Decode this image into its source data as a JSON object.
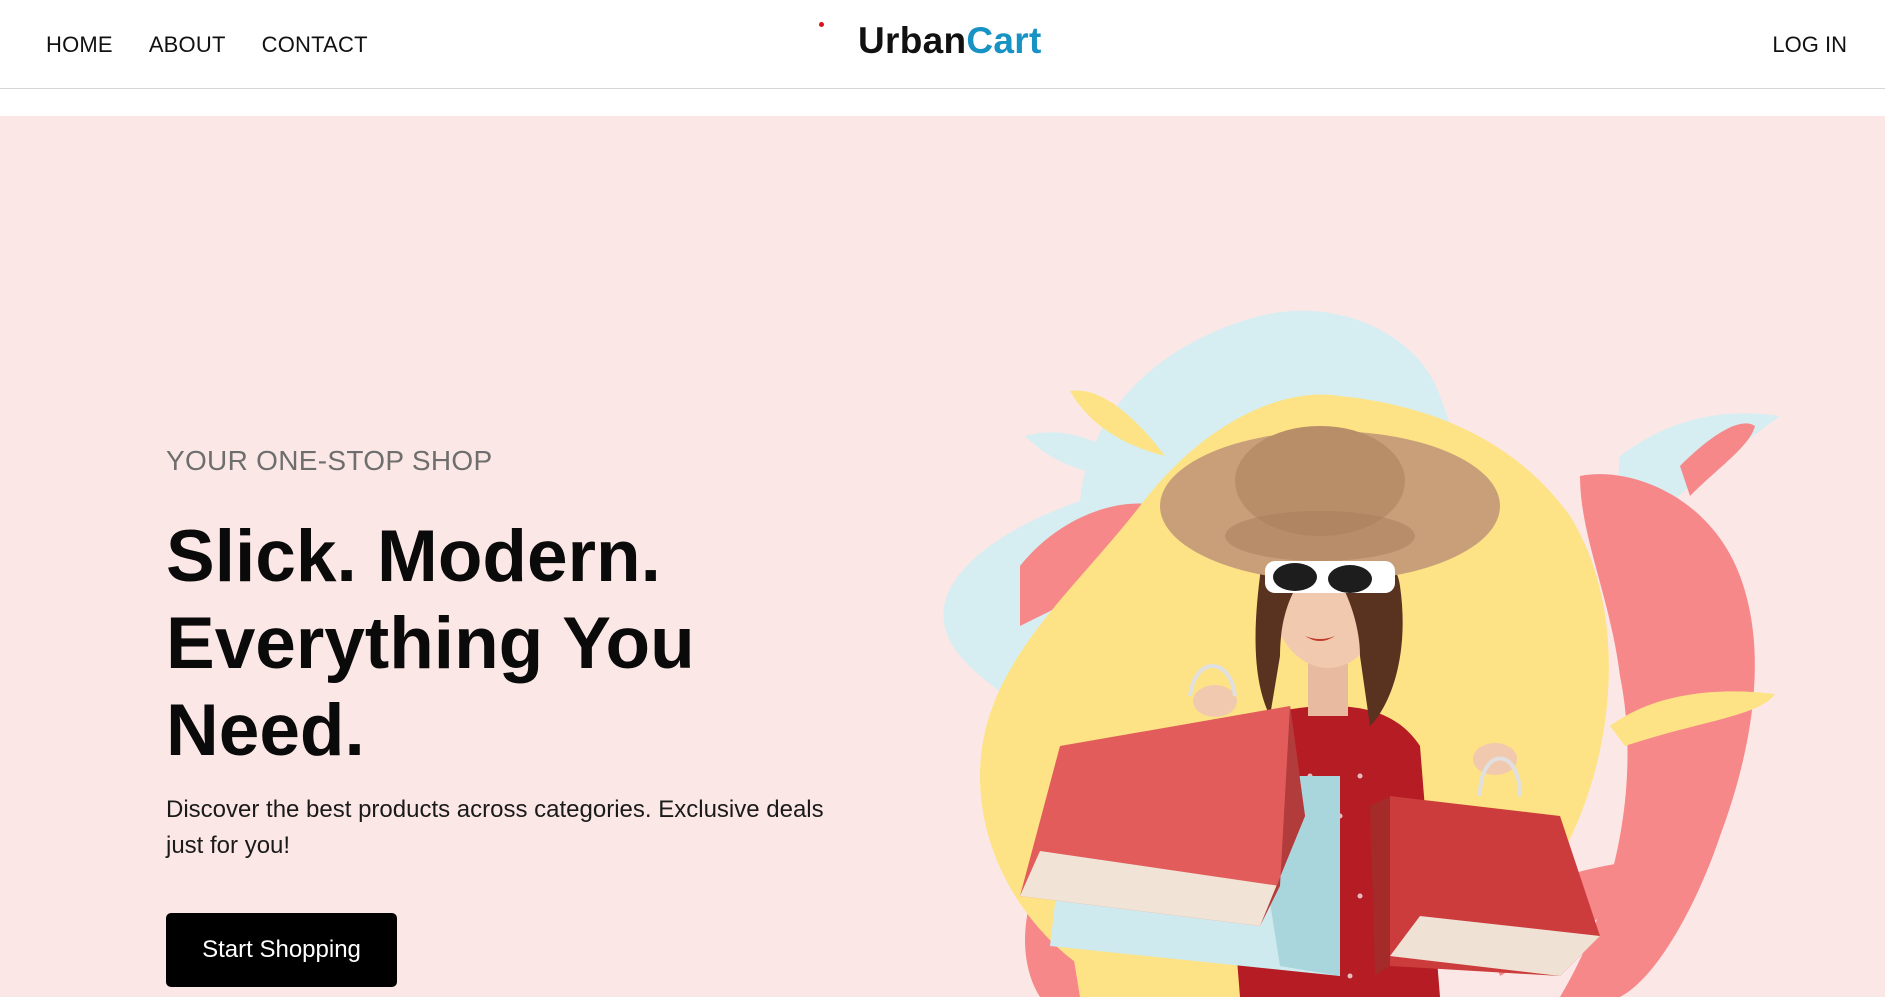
{
  "nav": {
    "links": [
      "HOME",
      "ABOUT",
      "CONTACT"
    ],
    "brand_part1": "Urban",
    "brand_part2": "Cart",
    "login_label": "LOG IN"
  },
  "hero": {
    "eyebrow": "YOUR ONE-STOP SHOP",
    "headline_line1": "Slick. Modern.",
    "headline_line2": "Everything You",
    "headline_line3": "Need.",
    "subtext": "Discover the best products across categories. Exclusive deals just for you!",
    "cta_label": "Start Shopping"
  },
  "colors": {
    "brand_accent": "#1692c4",
    "hero_bg": "#fbe8e6",
    "cta_bg": "#000000",
    "blob_yellow": "#fde385",
    "blob_blue": "#d6edf2",
    "blob_coral": "#f6888a"
  },
  "hero_image": {
    "subject": "woman-with-shopping-bags"
  }
}
